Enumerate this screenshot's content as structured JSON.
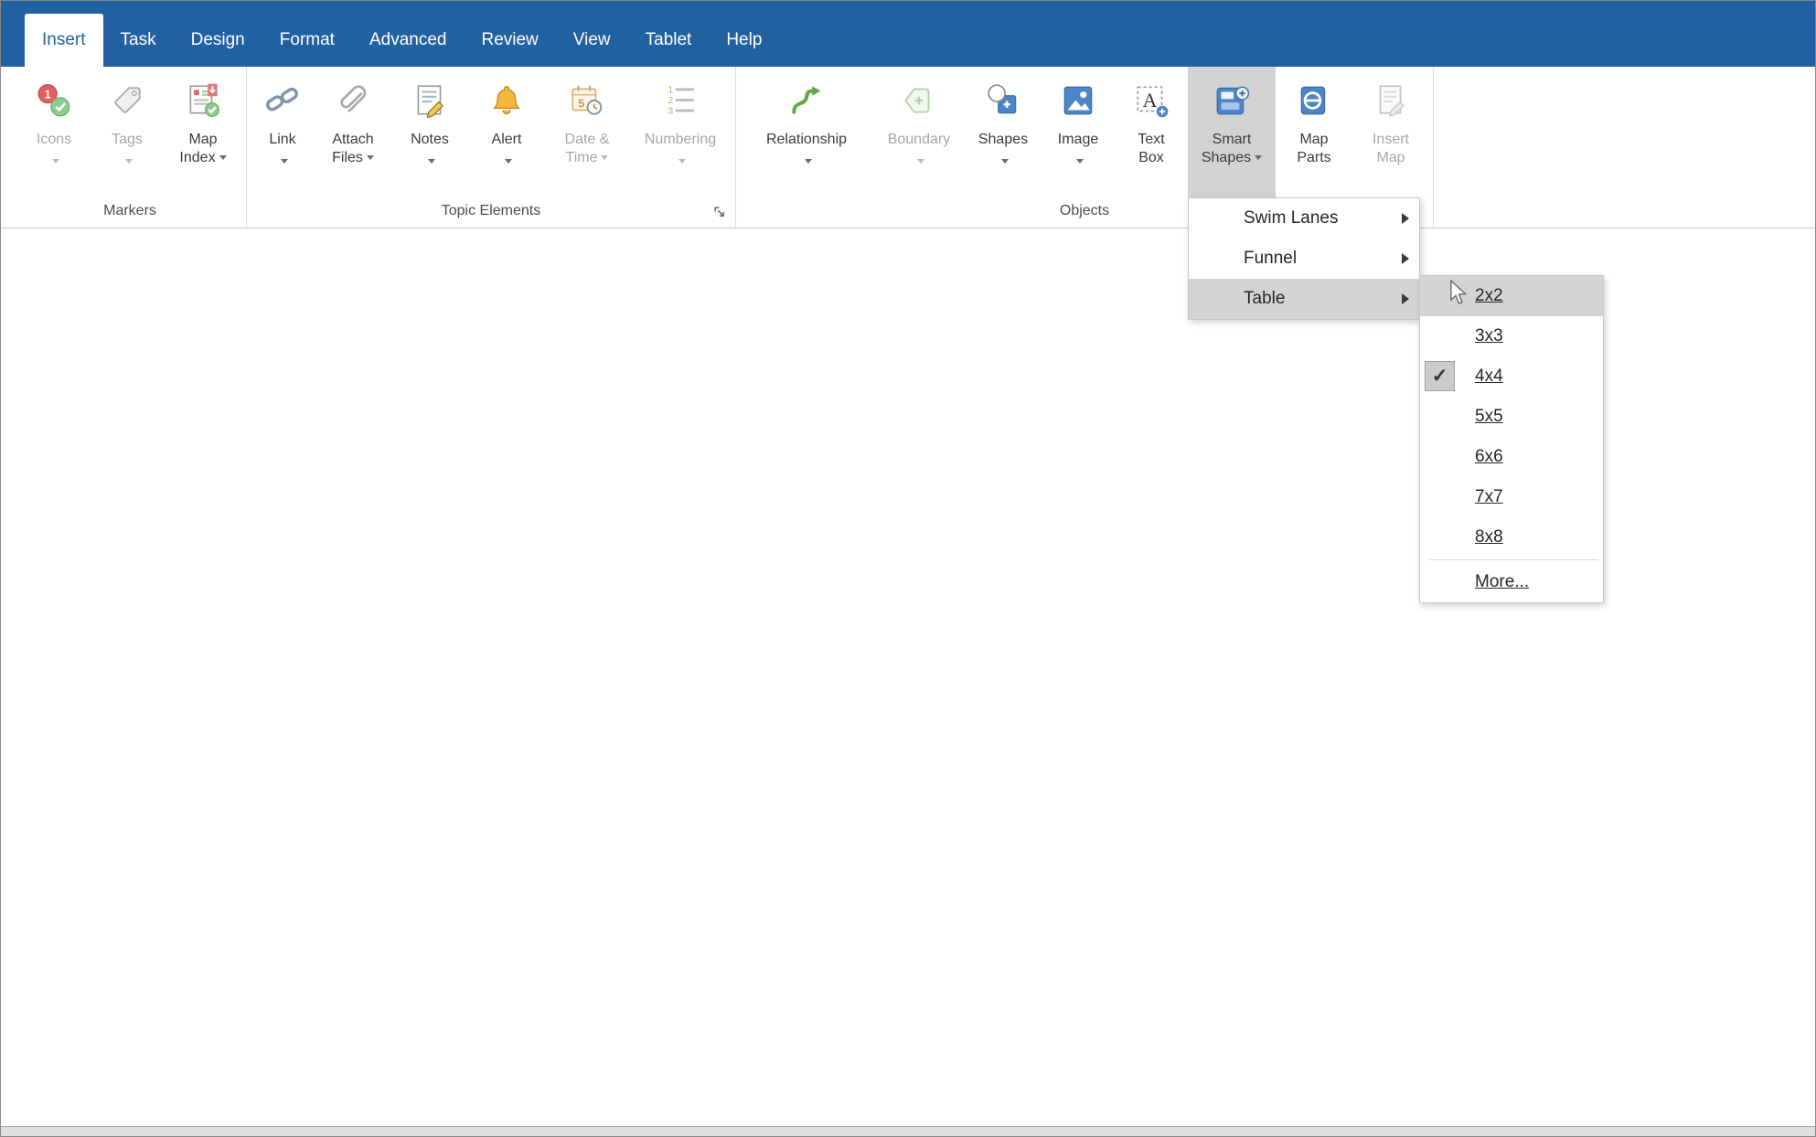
{
  "tabs": {
    "insert": "Insert",
    "task": "Task",
    "design": "Design",
    "format": "Format",
    "advanced": "Advanced",
    "review": "Review",
    "view": "View",
    "tablet": "Tablet",
    "help": "Help"
  },
  "groups": {
    "markers": {
      "label": "Markers",
      "icons": {
        "l1": "Icons"
      },
      "tags": {
        "l1": "Tags"
      },
      "map_index": {
        "l1": "Map",
        "l2": "Index"
      }
    },
    "topic_elements": {
      "label": "Topic Elements",
      "link": {
        "l1": "Link"
      },
      "attach_files": {
        "l1": "Attach",
        "l2": "Files"
      },
      "notes": {
        "l1": "Notes"
      },
      "alert": {
        "l1": "Alert"
      },
      "date_time": {
        "l1": "Date &",
        "l2": "Time"
      },
      "numbering": {
        "l1": "Numbering"
      }
    },
    "objects": {
      "label": "Objects",
      "relationship": {
        "l1": "Relationship"
      },
      "boundary": {
        "l1": "Boundary"
      },
      "shapes": {
        "l1": "Shapes"
      },
      "image": {
        "l1": "Image"
      },
      "text_box": {
        "l1": "Text",
        "l2": "Box"
      },
      "smart_shapes": {
        "l1": "Smart",
        "l2": "Shapes"
      },
      "map_parts": {
        "l1": "Map",
        "l2": "Parts"
      },
      "insert_map": {
        "l1": "Insert",
        "l2": "Map"
      }
    }
  },
  "smart_shapes_menu": {
    "swim_lanes": "Swim Lanes",
    "funnel": "Funnel",
    "table": "Table"
  },
  "table_submenu": {
    "sizes": [
      "2x2",
      "3x3",
      "4x4",
      "5x5",
      "6x6",
      "7x7",
      "8x8"
    ],
    "more": "More...",
    "checked_size": "4x4",
    "highlighted_size": "2x2",
    "check_glyph": "✓"
  },
  "colors": {
    "menubar_blue": "#2261A1",
    "active_tab_text": "#2261A1",
    "pressed_button_bg": "#D2D2D2",
    "menu_highlight": "#D4D4D4",
    "icon_blue": "#4C86C6",
    "relationship_green": "#5FA845",
    "alert_amber": "#F5B83D"
  }
}
